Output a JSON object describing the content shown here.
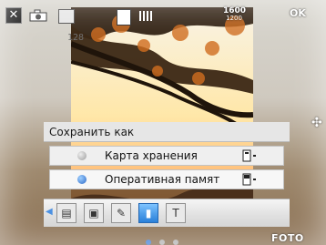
{
  "status": {
    "icons": [
      "close-icon",
      "camera-icon",
      "square-icon",
      "storage-icon",
      "signal-bars-icon",
      "resolution-icon",
      "ok-icon"
    ],
    "shot_count": "128",
    "resolution_top": "1600",
    "resolution_bottom": "1200",
    "ok_label": "OK"
  },
  "dialog": {
    "title": "Сохранить как",
    "options": [
      {
        "label": "Карта хранения",
        "selected": false,
        "icon": "memory-card-icon"
      },
      {
        "label": "Оперативная памят",
        "selected": true,
        "icon": "phone-memory-icon"
      }
    ],
    "tabs": [
      {
        "icon": "copy-icon",
        "active": false
      },
      {
        "icon": "frame-icon",
        "active": false
      },
      {
        "icon": "tools-icon",
        "active": false
      },
      {
        "icon": "memory-icon",
        "active": true
      },
      {
        "icon": "text-icon",
        "active": false
      }
    ]
  },
  "pagination": {
    "count": 3,
    "active_index": 0
  },
  "brand": "FOTO",
  "colors": {
    "accent": "#4b84d7",
    "dialog_bg": "#e6e6e6"
  }
}
